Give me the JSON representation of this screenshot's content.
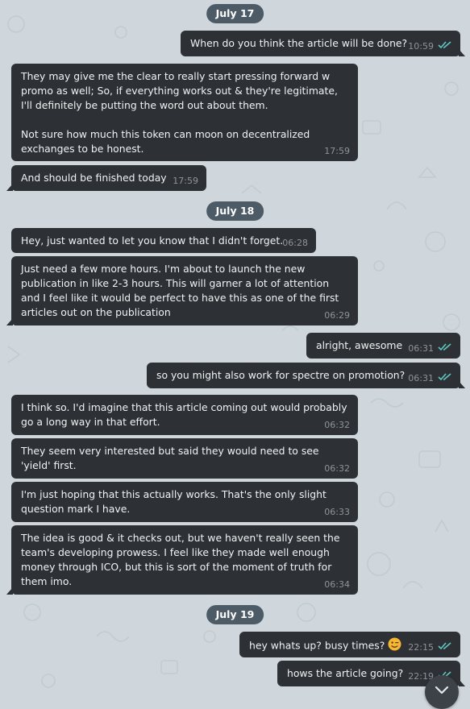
{
  "conversation": {
    "date_1": "July 17",
    "date_2": "July 18",
    "date_3": "July 19",
    "messages": [
      {
        "direction": "out",
        "text": "When do you think the article will be done?",
        "time": "10:59",
        "status": "read"
      },
      {
        "direction": "in",
        "paragraphs": [
          "They may give me the clear to really start pressing forward w promo as well; So, if everything works out & they're legitimate, I'll definitely be putting the word out about them.",
          "Not sure how much this token can moon on decentralized exchanges to be honest."
        ],
        "time": "17:59"
      },
      {
        "direction": "in",
        "text": "And should be finished today",
        "time": "17:59"
      },
      {
        "direction": "in",
        "text": "Hey, just wanted to let you know that I didn't forget.",
        "time": "06:28"
      },
      {
        "direction": "in",
        "text": "Just need a few more hours. I'm about to launch the new publication in like 2-3 hours. This will garner a lot of attention and I feel like it would be perfect to have this as one of the first articles out on the publication",
        "time": "06:29"
      },
      {
        "direction": "out",
        "text": "alright, awesome",
        "time": "06:31",
        "status": "read"
      },
      {
        "direction": "out",
        "text": "so you might also work for spectre on promotion?",
        "time": "06:31",
        "status": "read"
      },
      {
        "direction": "in",
        "text": "I think so. I'd imagine that this article coming out would probably go a long way in that effort.",
        "time": "06:32"
      },
      {
        "direction": "in",
        "text": "They seem very interested but said they would need to see 'yield' first.",
        "time": "06:32"
      },
      {
        "direction": "in",
        "text": "I'm just hoping that this actually works. That's the only slight question mark I have.",
        "time": "06:33"
      },
      {
        "direction": "in",
        "text": "The idea is good & it checks out, but we haven't really seen the team's developing prowess. I feel like they made well enough money through ICO, but this is sort of the moment of truth for them imo.",
        "time": "06:34"
      },
      {
        "direction": "out",
        "text": "hey whats up? busy times?",
        "emoji": "winking-face",
        "time": "22:15",
        "status": "read"
      },
      {
        "direction": "out",
        "text": "hows the article going?",
        "time": "22:19",
        "status": "read"
      }
    ]
  },
  "colors": {
    "chat_background": "#cfd6dc",
    "bubble": "#2d3035",
    "date_pill": "#4d5b66",
    "read_ticks": "#5fc8c0",
    "timestamp": "#8d949a"
  },
  "icons": {
    "read_status": "double-check-icon",
    "scroll_down": "chevron-down-icon"
  }
}
